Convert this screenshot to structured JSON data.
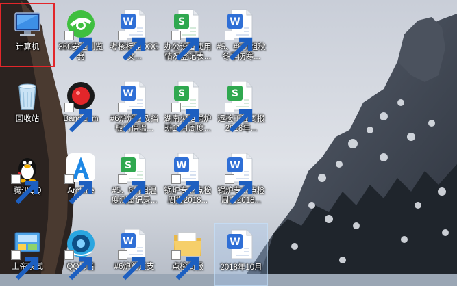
{
  "desktop": {
    "icons": [
      {
        "label": "计算机",
        "type": "computer"
      },
      {
        "label": "360安全浏览器",
        "type": "browser360"
      },
      {
        "label": "考核标准DOC 文...",
        "type": "word"
      },
      {
        "label": "办公设备使用情况登记表...",
        "type": "wps-sheet"
      },
      {
        "label": "#5、#6机组秋冬季防寒...",
        "type": "word"
      },
      {
        "label": "回收站",
        "type": "recycle"
      },
      {
        "label": "Bandicam",
        "type": "bandicam"
      },
      {
        "label": "#6炉炉墙及挡板门保温...",
        "type": "word"
      },
      {
        "label": "湖南火电锅炉班11月周度...",
        "type": "wps-sheet"
      },
      {
        "label": "运检工程周报 2018年...",
        "type": "wps-sheet"
      },
      {
        "label": "腾讯QQ",
        "type": "qq"
      },
      {
        "label": "Arctime",
        "type": "arctime"
      },
      {
        "label": "#5、6机组温度测量记录...",
        "type": "wps-sheet"
      },
      {
        "label": "锅炉专业点检周报2018...",
        "type": "word"
      },
      {
        "label": "锅炉专业点检周报2018...",
        "type": "word"
      },
      {
        "label": "上帝模式",
        "type": "godmode"
      },
      {
        "label": "QQ影音",
        "type": "qqplayer"
      },
      {
        "label": "#6炉管道支",
        "type": "word"
      },
      {
        "label": "点检周报",
        "type": "folder"
      },
      {
        "label": "2018年10月",
        "type": "word"
      }
    ]
  }
}
